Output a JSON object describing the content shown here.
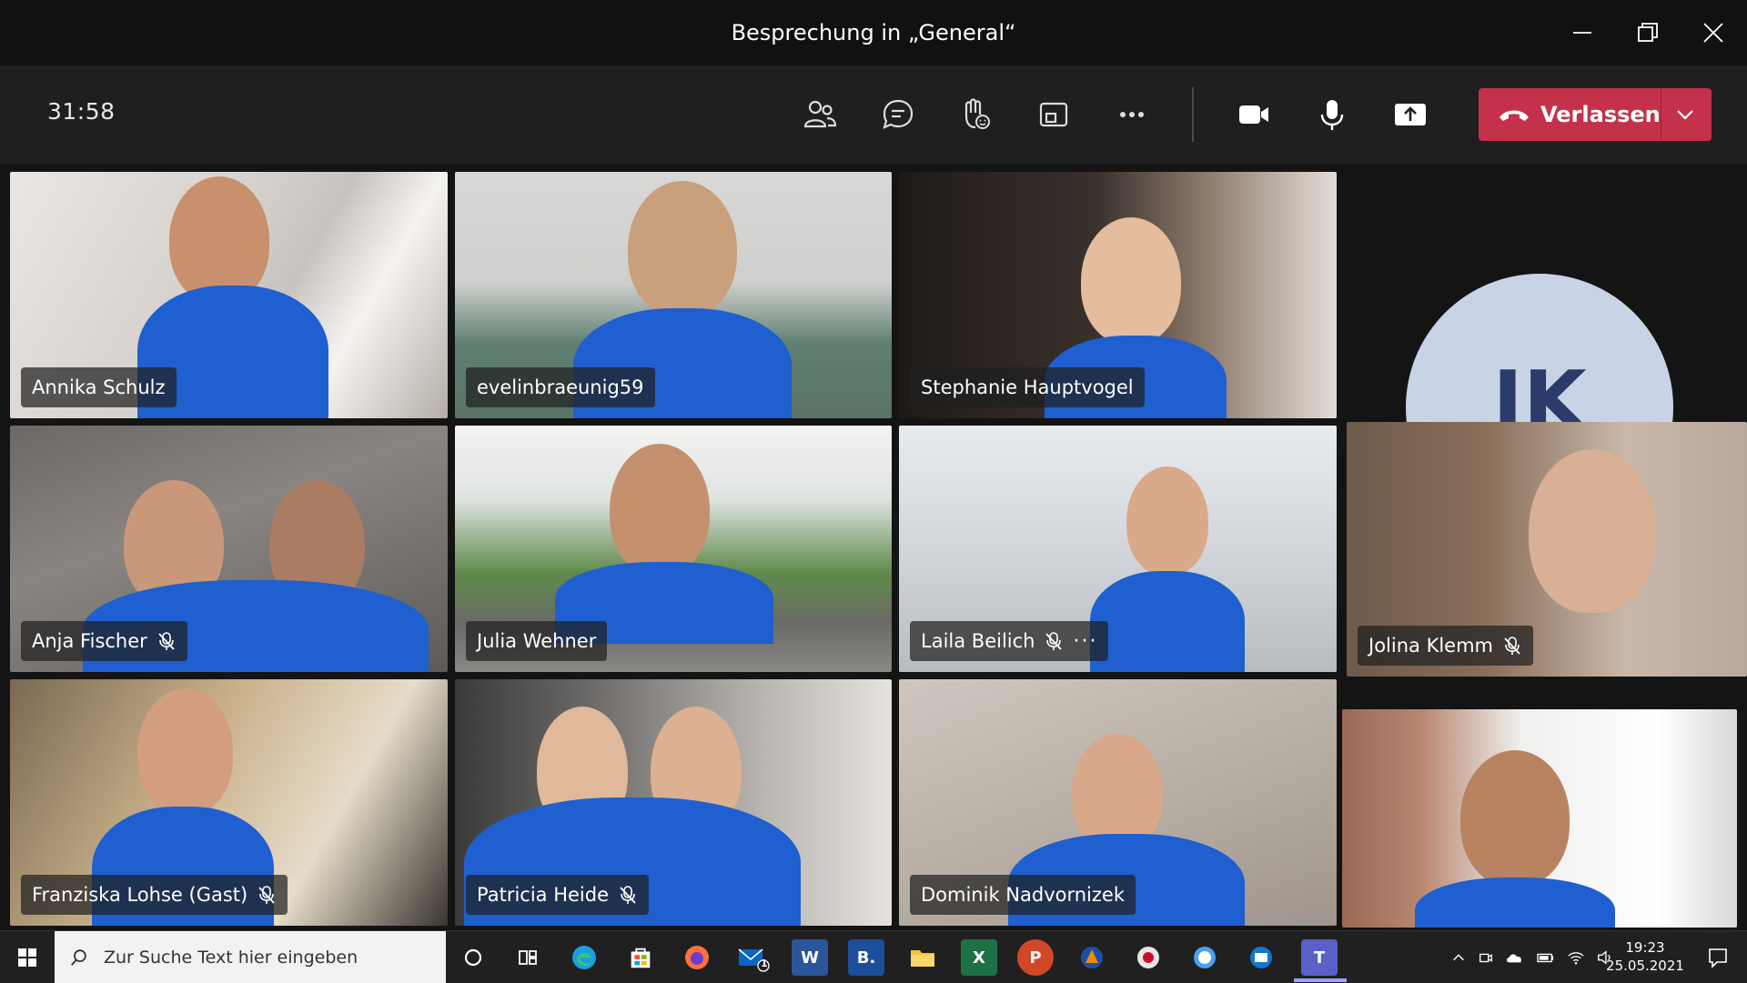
{
  "window": {
    "title": "Besprechung in „General“"
  },
  "toolbar": {
    "timer": "31:58",
    "leave_label": "Verlassen",
    "buttons": [
      "participants-icon",
      "chat-icon",
      "raise-hand-icon",
      "rooms-icon",
      "more-icon",
      "camera-icon",
      "microphone-icon",
      "share-icon"
    ]
  },
  "participants": [
    {
      "name": "Annika Schulz",
      "muted": false
    },
    {
      "name": "evelinbraeunig59",
      "muted": false
    },
    {
      "name": "Stephanie Hauptvogel",
      "muted": false
    },
    {
      "name": "Anja Fischer",
      "muted": true
    },
    {
      "name": "Julia Wehner",
      "muted": false
    },
    {
      "name": "Laila Beilich",
      "muted": true,
      "more": "···"
    },
    {
      "name": "Jolina Klemm",
      "muted": true
    },
    {
      "name": "Franziska Lohse (Gast)",
      "muted": true
    },
    {
      "name": "Patricia Heide",
      "muted": true
    },
    {
      "name": "Dominik Nadvornizek",
      "muted": false
    }
  ],
  "avatar_tile": {
    "initials": "JK"
  },
  "taskbar": {
    "search_placeholder": "Zur Suche Text hier eingeben",
    "apps": [
      "task-view-icon",
      "edge-icon",
      "store-icon",
      "firefox-icon",
      "mail-icon",
      "word-icon",
      "b-app-icon",
      "explorer-icon",
      "excel-icon",
      "powerpoint-icon",
      "vlc-icon",
      "app-icon",
      "app-icon",
      "outlook-icon",
      "teams-icon"
    ],
    "mail_badge": "1",
    "word_letter": "W",
    "b_letter": "B.",
    "excel_letter": "X",
    "ppt_letter": "P",
    "teams_letter": "T",
    "time": "19:23",
    "date": "25.05.2021"
  },
  "colors": {
    "leave": "#c4314b",
    "shirt": "#1f5fcf",
    "teams_accent": "#5b5fc7"
  }
}
